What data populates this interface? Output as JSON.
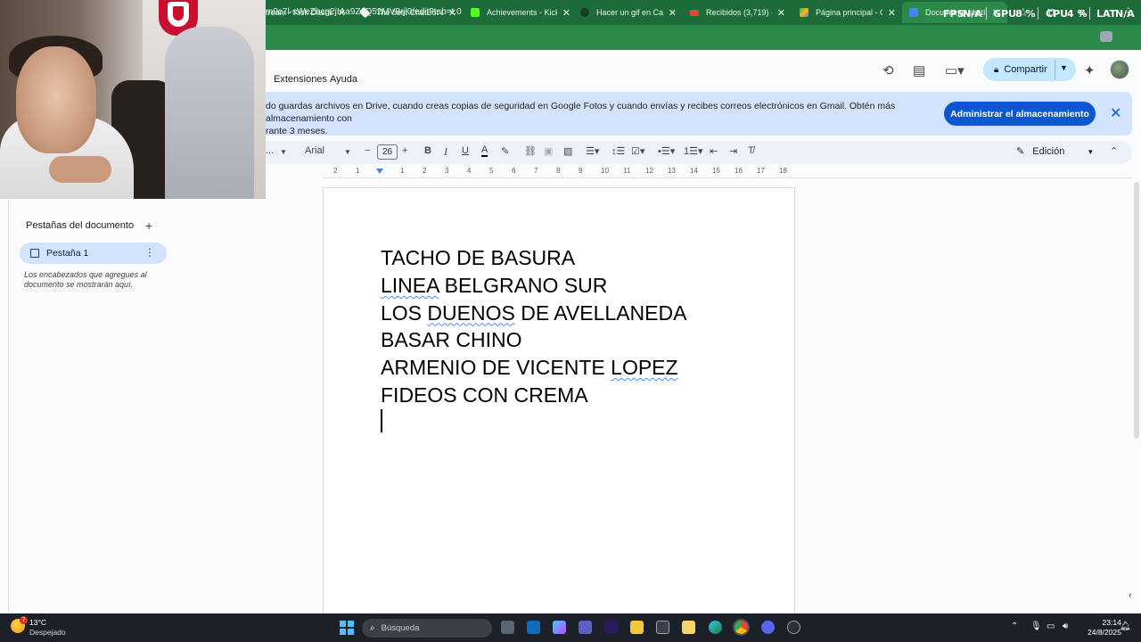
{
  "browser": {
    "tabs": [
      {
        "label": "tream - Kick Dashbo",
        "icon": "kick-icon",
        "color": "#53fc18"
      },
      {
        "label": "The best ChatBot and",
        "icon": "diamond-icon",
        "color": "#ffffff"
      },
      {
        "label": "Achievements - Kick",
        "icon": "kick-icon",
        "color": "#53fc18"
      },
      {
        "label": "Hacer un gif en Canv",
        "icon": "canva-icon",
        "color": "#1a3d2a"
      },
      {
        "label": "Recibidos (3,719) - al",
        "icon": "gmail-icon",
        "color": "#ea4335"
      },
      {
        "label": "Página principal - Go",
        "icon": "drive-icon",
        "color": "#fbbc04"
      },
      {
        "label": "Documento sin título",
        "icon": "docs-icon",
        "color": "#4285f4"
      }
    ],
    "url": "m9c7l-sWeZhcg2jIAa9ZsQ52MV8rjl0/edit?tab=t.0",
    "hud": {
      "fps_label": "FPS",
      "fps_value": "N/A",
      "gpu_label": "GPU",
      "gpu_value": "8 %",
      "cpu_label": "CPU",
      "cpu_value": "4 %",
      "lat_label": "LAT",
      "lat_value": "N/A"
    }
  },
  "docs": {
    "menu": {
      "extensions": "Extensiones",
      "help": "Ayuda"
    },
    "share_label": "Compartir",
    "banner": {
      "text": "do guardas archivos en Drive, cuando creas copias de seguridad en Google Fotos y cuando envías y recibes correos electrónicos en Gmail. Obtén más almacenamiento con",
      "text2": "rante 3 meses.",
      "button": "Administrar el almacenamiento"
    },
    "toolbar": {
      "style_dropdown": "...",
      "font": "Arial",
      "font_size": "26",
      "bold": "B",
      "italic": "I",
      "underline": "U",
      "text_color": "A",
      "edit_mode": "Edición"
    },
    "ruler_labels": [
      "2",
      "1",
      "1",
      "2",
      "3",
      "4",
      "5",
      "6",
      "7",
      "8",
      "9",
      "10",
      "11",
      "12",
      "13",
      "14",
      "15",
      "16",
      "17",
      "18"
    ],
    "sidebar": {
      "heading": "Pestañas del documento",
      "tab_label": "Pestaña 1",
      "note": "Los encabezados que agregues al documento se mostrarán aquí."
    },
    "content": {
      "line1": "TACHO DE BASURA",
      "line2a": "LINEA",
      "line2b": " BELGRANO SUR",
      "line3a": "LOS ",
      "line3b": "DUENOS",
      "line3c": " DE AVELLANEDA",
      "line4": "BASAR CHINO",
      "line5a": "ARMENIO DE VICENTE ",
      "line5b": "LOPEZ",
      "line6": "FIDEOS CON CREMA"
    }
  },
  "taskbar": {
    "weather_badge": "7",
    "temperature": "13°C",
    "weather": "Despejado",
    "search_placeholder": "Búsqueda",
    "time": "23:14",
    "date": "24/8/2025"
  }
}
